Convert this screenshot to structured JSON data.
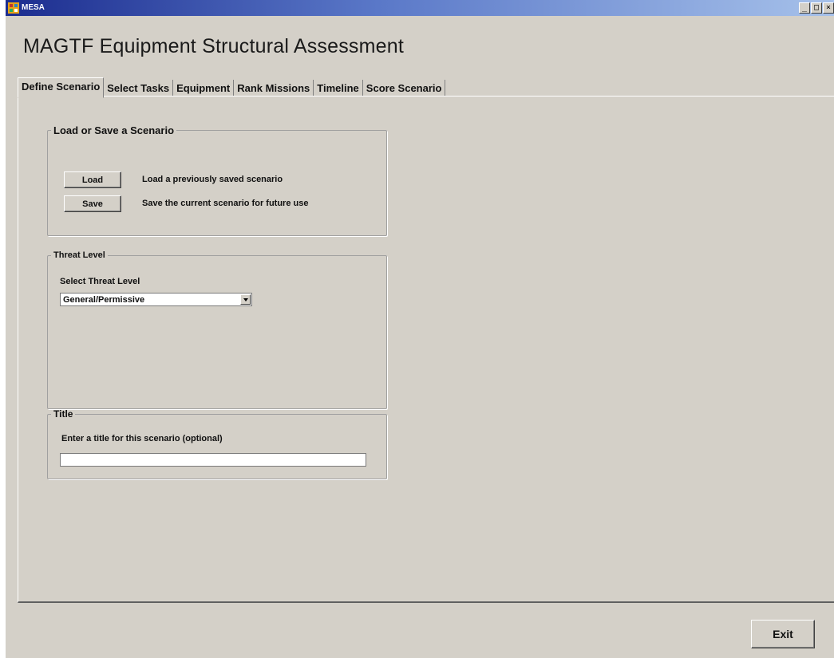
{
  "window": {
    "title": "MESA",
    "controls": {
      "minimize": "_",
      "maximize": "□",
      "close": "×"
    }
  },
  "app": {
    "title": "MAGTF Equipment Structural Assessment"
  },
  "tabs": [
    {
      "label": "Define Scenario",
      "active": true
    },
    {
      "label": "Select Tasks",
      "active": false
    },
    {
      "label": "Equipment",
      "active": false
    },
    {
      "label": "Rank Missions",
      "active": false
    },
    {
      "label": "Timeline",
      "active": false
    },
    {
      "label": "Score Scenario",
      "active": false
    }
  ],
  "load_save": {
    "legend": "Load or Save a Scenario",
    "load_button": "Load",
    "load_description": "Load a previously saved scenario",
    "save_button": "Save",
    "save_description": "Save the current scenario for future use"
  },
  "threat": {
    "legend": "Threat Level",
    "prompt": "Select Threat Level",
    "selected": "General/Permissive"
  },
  "title_group": {
    "legend": "Title",
    "prompt": "Enter a title for this scenario (optional)",
    "value": ""
  },
  "footer": {
    "exit_button": "Exit"
  },
  "icons": [
    "app-icon",
    "minimize-icon",
    "maximize-icon",
    "close-icon",
    "dropdown-arrow-icon"
  ]
}
